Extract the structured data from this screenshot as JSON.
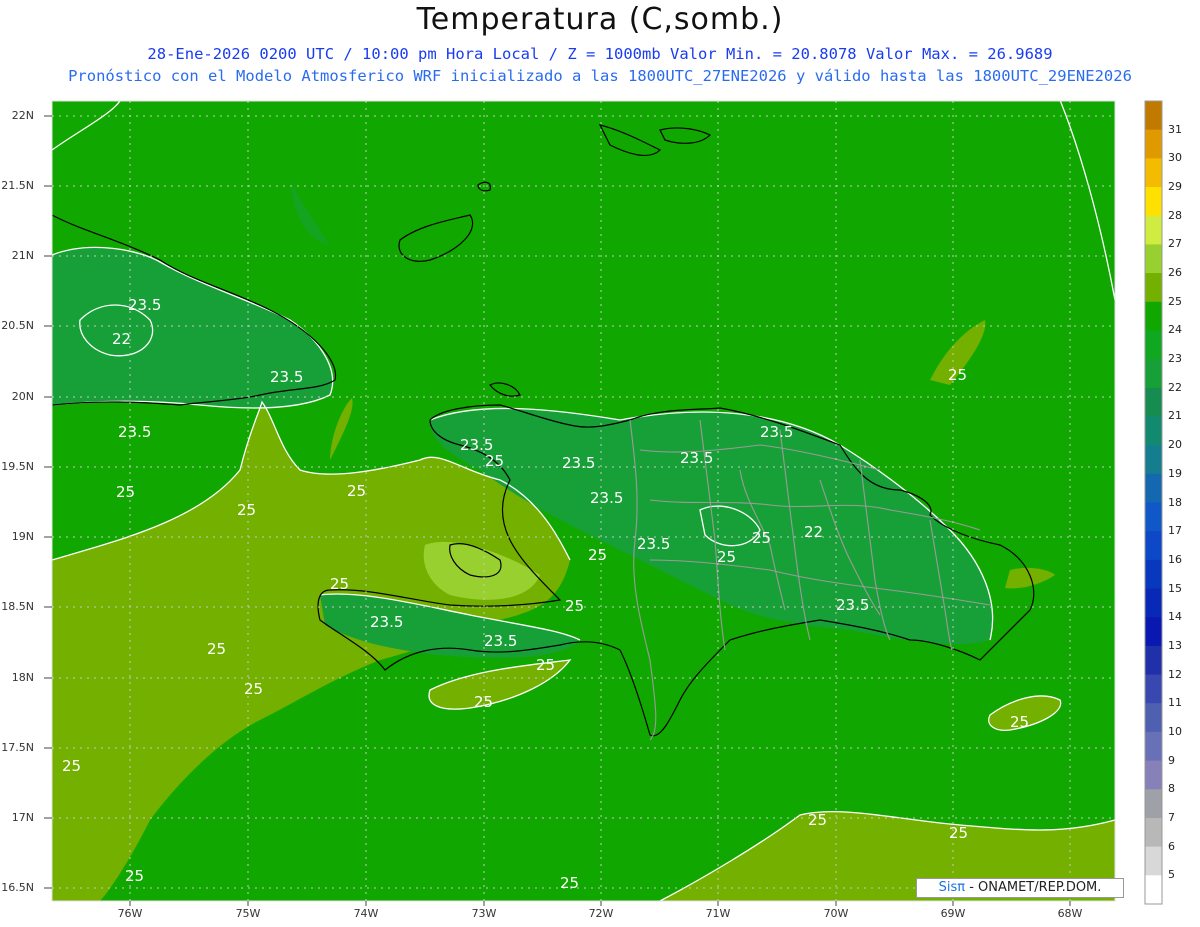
{
  "title": "Temperatura (C,somb.)",
  "subtitle_line1": "28-Ene-2026 0200 UTC / 10:00 pm Hora Local / Z = 1000mb  Valor Min. = 20.8078  Valor Max. = 26.9689",
  "subtitle_line2": "Pronóstico con el Modelo Atmosferico WRF inicializado a las 1800UTC_27ENE2026 y válido hasta las  1800UTC_29ENE2026",
  "lat_labels": [
    "22N",
    "21.5N",
    "21N",
    "20.5N",
    "20N",
    "19.5N",
    "19N",
    "18.5N",
    "18N",
    "17.5N",
    "17N",
    "16.5N"
  ],
  "lon_labels": [
    "76W",
    "75W",
    "74W",
    "73W",
    "72W",
    "71W",
    "70W",
    "69W",
    "68W"
  ],
  "colorbar_labels": [
    "31",
    "30",
    "29",
    "28",
    "27",
    "26",
    "25",
    "24",
    "23",
    "22",
    "21",
    "20",
    "19",
    "18",
    "17",
    "16",
    "15",
    "14",
    "13",
    "12",
    "11",
    "10",
    "9",
    "8",
    "7",
    "6",
    "5"
  ],
  "colorbar_colors": [
    "#c07a00",
    "#e09a00",
    "#f4bc00",
    "#ffe000",
    "#d0ec40",
    "#98d030",
    "#74b000",
    "#10a800",
    "#10a820",
    "#18a038",
    "#168c50",
    "#128a70",
    "#147e90",
    "#1468b0",
    "#1058c8",
    "#0c48c8",
    "#0838c0",
    "#0828b8",
    "#0818b0",
    "#2030a8",
    "#3848b0",
    "#5060b0",
    "#6870b8",
    "#8880b8",
    "#a0a0a8",
    "#b8b8b8",
    "#d8d8d8",
    "#ffffff"
  ],
  "contour_labels": [
    "23.5",
    "22",
    "23.5",
    "23.5",
    "25",
    "25",
    "23.5",
    "25",
    "23.5",
    "23.5",
    "25",
    "23.5",
    "23.5",
    "25",
    "25",
    "22",
    "23.5",
    "25",
    "25",
    "23.5",
    "25",
    "23.5",
    "23.5",
    "25",
    "25",
    "25",
    "25",
    "25",
    "25",
    "25",
    "25",
    "25",
    "25",
    "25"
  ],
  "credit": {
    "brand": "Sisπ",
    "text": " - ONAMET/REP.DOM."
  },
  "colors": {
    "sea": "#10a800",
    "land_warm": "#74b000",
    "land_cool": "#18a038",
    "contour": "#ffffff",
    "coast": "#000000",
    "border": "#999999"
  }
}
